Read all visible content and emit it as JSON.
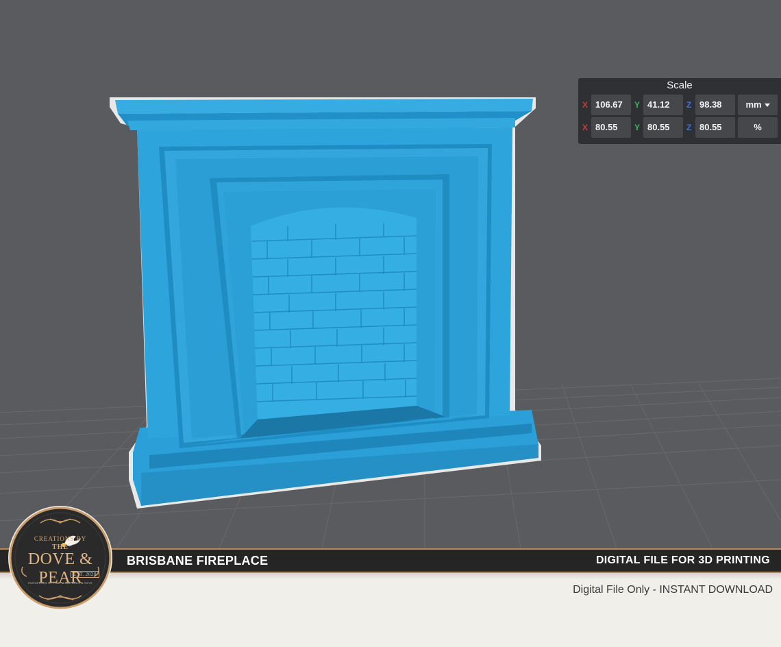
{
  "scale_panel": {
    "title": "Scale",
    "rows": [
      {
        "x": "106.67",
        "y": "41.12",
        "z": "98.38",
        "unit": "mm"
      },
      {
        "x": "80.55",
        "y": "80.55",
        "z": "80.55",
        "unit": "%"
      }
    ],
    "axis_labels": {
      "x": "X",
      "y": "Y",
      "z": "Z"
    },
    "axis_colors": {
      "x": "#c73b3b",
      "y": "#3fb45a",
      "z": "#3f72d8"
    }
  },
  "model": {
    "color": "#2a9fd8",
    "shadow_color": "#1d7eae"
  },
  "banner": {
    "product_title": "BRISBANE FIREPLACE",
    "file_type": "DIGITAL FILE FOR 3D PRINTING",
    "download_note": "Digital File Only - INSTANT DOWNLOAD"
  },
  "logo": {
    "line1": "CREATIONS BY",
    "line2": "THE",
    "brand": "DOVE & PEAR",
    "est": "EST. 2020",
    "tagline": "PURVEYORS OF FINE MINIATURES & TOYS"
  }
}
